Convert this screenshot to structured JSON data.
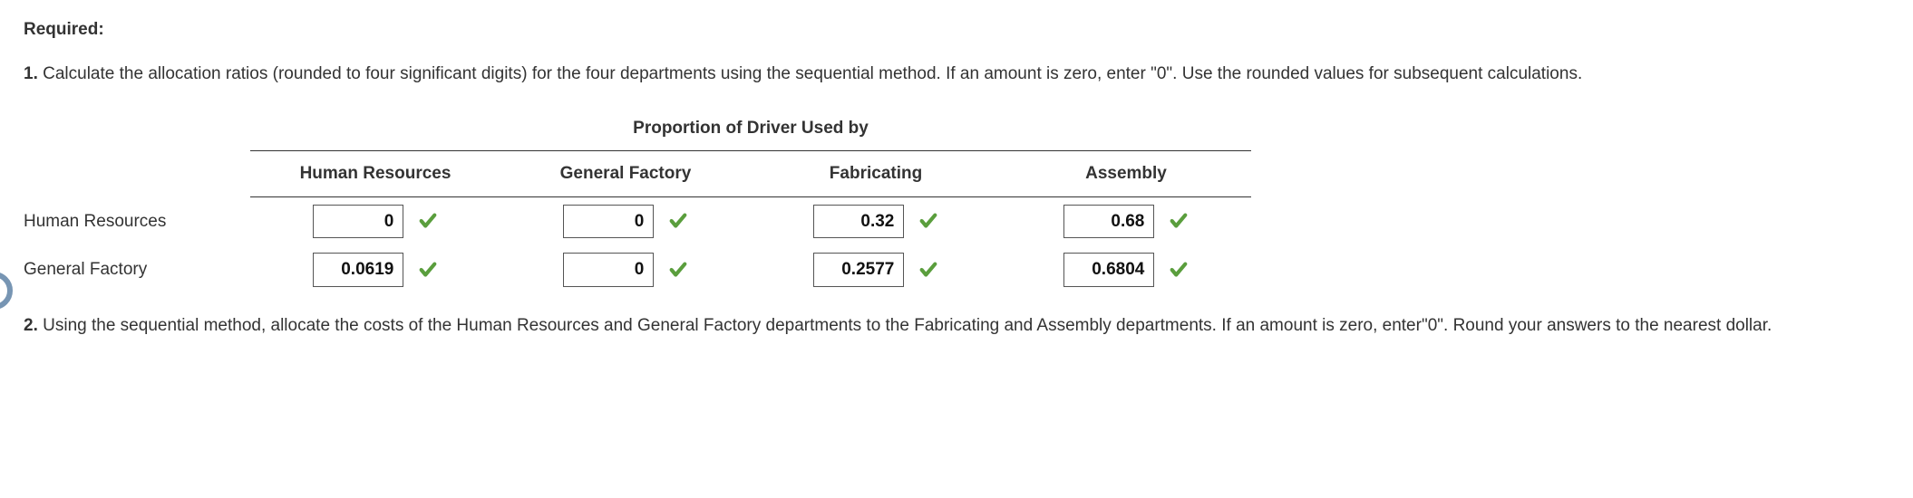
{
  "heading": "Required:",
  "q1": {
    "num": "1.",
    "text": " Calculate the allocation ratios (rounded to four significant digits) for the four departments using the sequential method. If an amount is zero, enter \"0\". Use the rounded values for subsequent calculations."
  },
  "table": {
    "span_header": "Proportion of Driver Used by",
    "columns": [
      "Human Resources",
      "General Factory",
      "Fabricating",
      "Assembly"
    ],
    "rows": [
      {
        "label": "Human Resources",
        "cells": [
          {
            "value": "0",
            "correct": true
          },
          {
            "value": "0",
            "correct": true
          },
          {
            "value": "0.32",
            "correct": true
          },
          {
            "value": "0.68",
            "correct": true
          }
        ]
      },
      {
        "label": "General Factory",
        "cells": [
          {
            "value": "0.0619",
            "correct": true
          },
          {
            "value": "0",
            "correct": true
          },
          {
            "value": "0.2577",
            "correct": true
          },
          {
            "value": "0.6804",
            "correct": true
          }
        ]
      }
    ]
  },
  "q2": {
    "num": "2.",
    "text": " Using the sequential method, allocate the costs of the Human Resources and General Factory departments to the Fabricating and Assembly departments. If an amount is zero, enter\"0\". Round your answers to the nearest dollar."
  },
  "icons": {
    "check_color": "#5a9e3d"
  }
}
